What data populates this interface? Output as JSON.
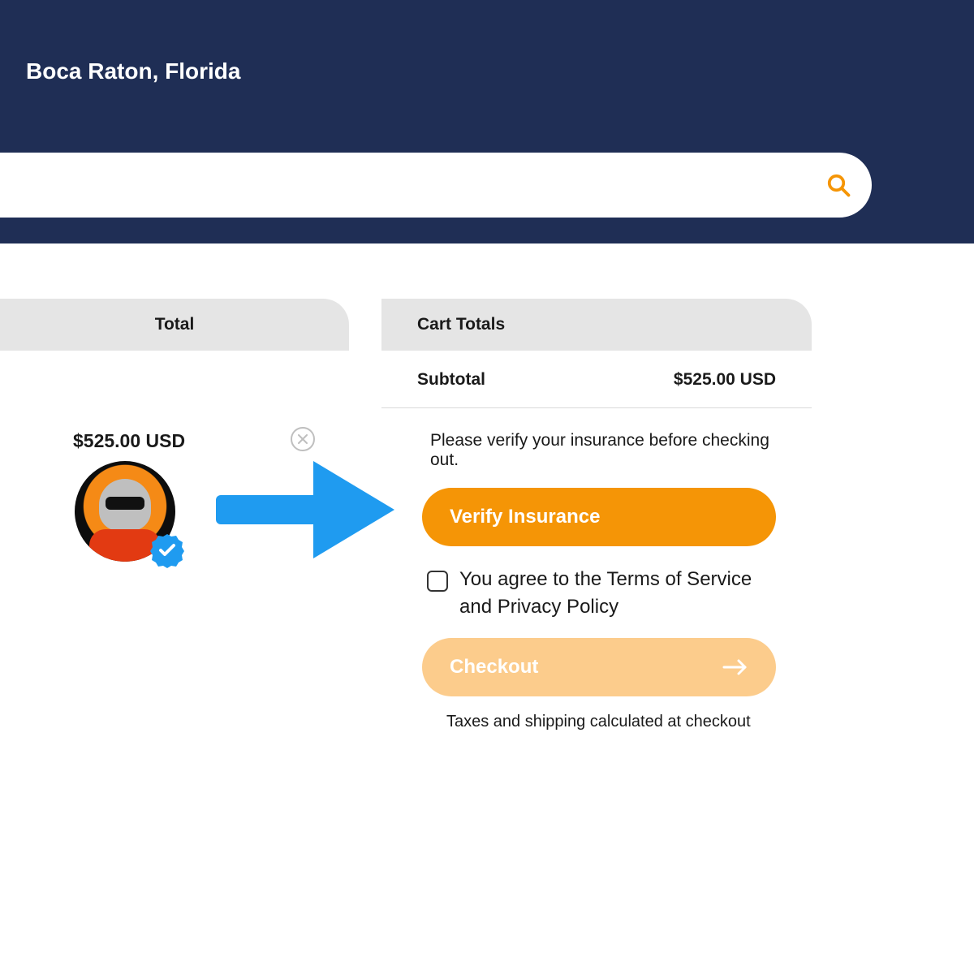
{
  "header": {
    "location": "Boca Raton, Florida"
  },
  "left_panel": {
    "heading": "Total",
    "item_price": "$525.00 USD"
  },
  "right_panel": {
    "heading": "Cart Totals",
    "subtotal_label": "Subtotal",
    "subtotal_value": "$525.00 USD",
    "instruction": "Please verify your insurance before checking out.",
    "verify_label": "Verify Insurance",
    "tos_text": "You agree to the Terms of Service and Privacy Policy",
    "checkout_label": "Checkout",
    "tax_note": "Taxes and shipping calculated at checkout"
  },
  "colors": {
    "primary": "#f59506",
    "primary_light": "#fccc8c",
    "header_bg": "#1f2e55",
    "accent_blue": "#1f9bf0"
  }
}
